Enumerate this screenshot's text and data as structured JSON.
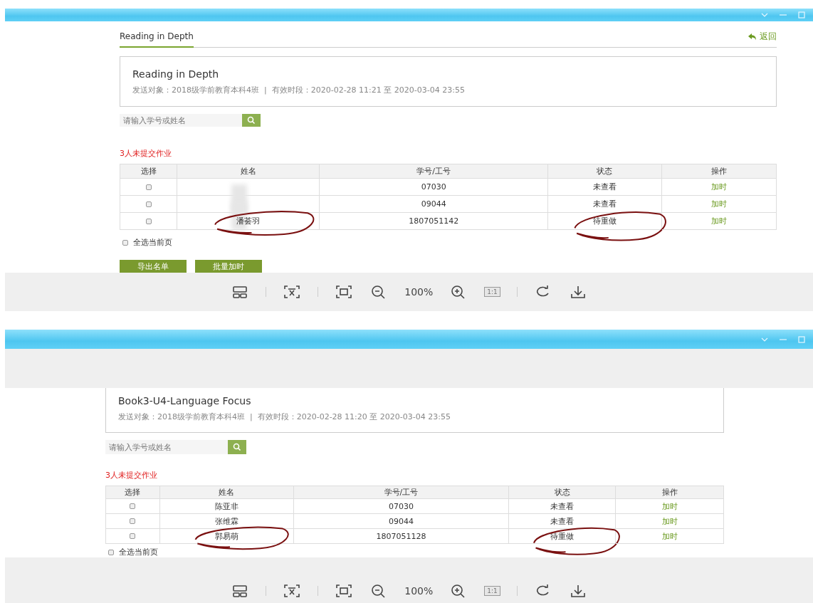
{
  "viewers": [
    {
      "kind": "page-top",
      "tab": {
        "label": "Reading in Depth",
        "selected": true
      },
      "back_link": "返回",
      "card": {
        "title": "Reading in Depth",
        "meta": "发送对象：2018级学前教育本科4班  |  有效时段：2020-02-28 11:21 至 2020-03-04 23:55"
      },
      "search": {
        "placeholder": "请输入学号或姓名"
      },
      "notice": "3人未提交作业",
      "table": {
        "columns": [
          "选择",
          "姓名",
          "学号/工号",
          "状态",
          "操作"
        ],
        "rows": [
          {
            "checked": false,
            "blurred": true,
            "number": "07030",
            "status": "未查看",
            "action": "加时",
            "circled": false
          },
          {
            "checked": false,
            "blurred": true,
            "number": "09044",
            "status": "未查看",
            "action": "加时",
            "circled": false
          },
          {
            "checked": false,
            "blurred": false,
            "name": "潘荟羽",
            "number": "1807051142",
            "status": "待重做",
            "action": "加时",
            "circled": true
          }
        ]
      },
      "select_all": {
        "label": "全选当前页",
        "checked": false
      },
      "buttons": [
        "导出名单",
        "批量加时"
      ],
      "zoom": "100%",
      "actual_size": "1:1"
    },
    {
      "kind": "page-scrolled",
      "card": {
        "title": "Book3-U4-Language Focus",
        "meta": "发送对象：2018级学前教育本科4班  |  有效时段：2020-02-28 11:20 至 2020-03-04 23:55"
      },
      "search": {
        "placeholder": "请输入学号或姓名"
      },
      "notice": "3人未提交作业",
      "table": {
        "columns": [
          "选择",
          "姓名",
          "学号/工号",
          "状态",
          "操作"
        ],
        "rows": [
          {
            "checked": false,
            "blurred": false,
            "name": "陈亚非",
            "number": "07030",
            "status": "未查看",
            "action": "加时",
            "circled": false
          },
          {
            "checked": false,
            "blurred": false,
            "name": "张维霖",
            "number": "09044",
            "status": "未查看",
            "action": "加时",
            "circled": false
          },
          {
            "checked": false,
            "blurred": false,
            "name": "郭易萌",
            "number": "1807051128",
            "status": "待重做",
            "action": "加时",
            "circled": true
          }
        ]
      },
      "select_all": {
        "label": "全选当前页",
        "checked": false
      },
      "zoom": "100%",
      "actual_size": "1:1"
    }
  ]
}
